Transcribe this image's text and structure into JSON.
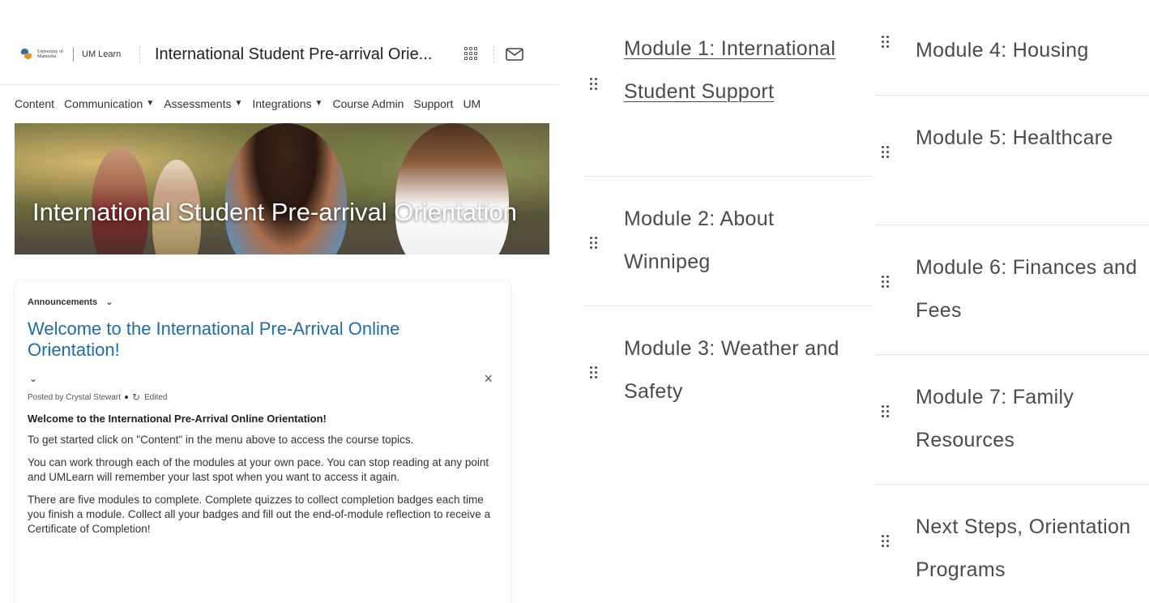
{
  "header": {
    "logo_university": "University of Manitoba",
    "logo_app": "UM Learn",
    "course_title": "International Student Pre-arrival Orie...",
    "icons": [
      "waffle-grid-icon",
      "mail-icon"
    ]
  },
  "nav": {
    "items": [
      {
        "label": "Content",
        "has_menu": false
      },
      {
        "label": "Communication",
        "has_menu": true
      },
      {
        "label": "Assessments",
        "has_menu": true
      },
      {
        "label": "Integrations",
        "has_menu": true
      },
      {
        "label": "Course Admin",
        "has_menu": false
      },
      {
        "label": "Support",
        "has_menu": false
      },
      {
        "label": "UM",
        "has_menu": false
      }
    ],
    "caret": "⌄"
  },
  "banner": {
    "title": "International Student Pre-arrival Orientation"
  },
  "announcements": {
    "header_label": "Announcements",
    "title": "Welcome to the International Pre-Arrival Online Orientation!",
    "posted_by": "Posted by Crystal Stewart",
    "edited_label": "Edited",
    "body_title": "Welcome to the International Pre-Arrival Online Orientation!",
    "paragraphs": [
      "To get started click on \"Content\" in the menu above to access the course topics.",
      "You can work through each of the modules at your own pace.  You can stop reading at any point and UMLearn will remember your last spot when you want to access it again.",
      "There are five modules to complete. Complete quizzes to collect completion badges each time you finish a module. Collect all your badges and fill out the end-of-module reflection to receive a Certificate of Completion!"
    ]
  },
  "modules": {
    "column1": [
      {
        "label": "Module 1: International Student Support",
        "is_link": true
      },
      {
        "label": "Module 2: About Winnipeg",
        "is_link": false
      },
      {
        "label": "Module 3: Weather and Safety",
        "is_link": false
      }
    ],
    "column2": [
      {
        "label": "Module 4: Housing",
        "is_link": false
      },
      {
        "label": "Module 5: Healthcare",
        "is_link": false
      },
      {
        "label": "Module 6: Finances and Fees",
        "is_link": false
      },
      {
        "label": "Module 7: Family Resources",
        "is_link": false
      },
      {
        "label": "Next Steps, Orientation Programs",
        "is_link": false
      }
    ]
  },
  "colors": {
    "link_blue": "#1d6ea8",
    "module_text": "#494c4e",
    "divider": "#e3e3e3"
  }
}
